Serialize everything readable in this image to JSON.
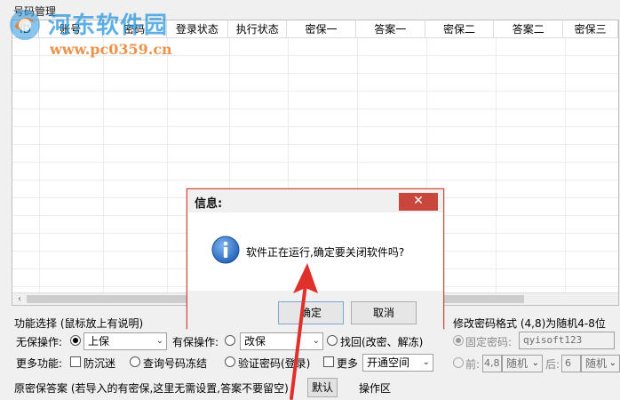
{
  "window": {
    "groupbox_title": "号码管理"
  },
  "watermark": {
    "cn": "河东软件园",
    "url": "www.pc0359.cn"
  },
  "grid": {
    "columns": [
      "ID",
      "账号",
      "密码",
      "登录状态",
      "执行状态",
      "密保一",
      "答案一",
      "密保二",
      "答案二",
      "密保三"
    ]
  },
  "function_panel": {
    "title": "功能选择 (鼠标放上有说明)",
    "no_protect_label": "无保操作:",
    "no_protect_select": "上保",
    "protect_label": "有保操作:",
    "protect_select": "改保",
    "recover_label": "找回(改密、解冻)",
    "more_label": "更多功能:",
    "anti_addiction": "防沉迷",
    "query_frozen": "查询号码冻结",
    "verify_password": "验证密码(登录)",
    "more_check": "更多",
    "more_select": "开通空间"
  },
  "password_panel": {
    "title": "修改密码格式 (4,8)为随机4-8位",
    "fixed_label": "固定密码:",
    "fixed_value": "qyisoft123",
    "front_label": "前:",
    "front_value": "4,8",
    "front_mode": "随机",
    "back_label": "后:",
    "back_value": "6",
    "back_mode": "随机"
  },
  "bottom": {
    "original_label": "原密保答案 (若导入的有密保,这里无需设置,答案不要留空)",
    "default_button": "默认",
    "operation_area": "操作区"
  },
  "dialog": {
    "title": "信息:",
    "close": "✕",
    "message": "软件正在运行,确定要关闭软件吗?",
    "ok": "确定",
    "cancel": "取消"
  },
  "colors": {
    "close_red": "#c8463b",
    "arrow_red": "#e0302b",
    "info_blue": "#2a6fc9"
  }
}
